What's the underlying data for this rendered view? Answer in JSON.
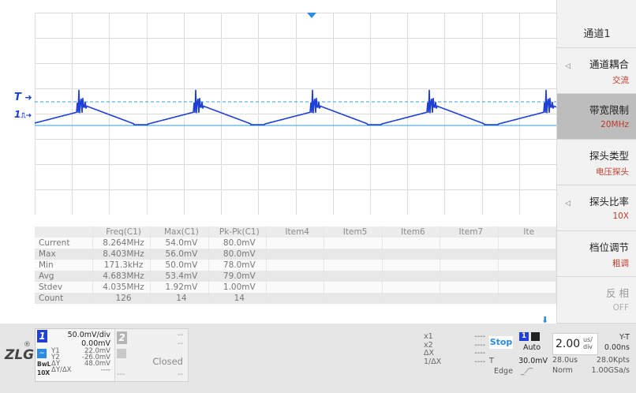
{
  "markers": {
    "trigger": "T",
    "channel": "1"
  },
  "measure": {
    "headers": [
      "",
      "Freq(C1)",
      "Max(C1)",
      "Pk-Pk(C1)",
      "Item4",
      "Item5",
      "Item6",
      "Item7",
      "Ite"
    ],
    "rows": [
      {
        "label": "Current",
        "values": [
          "8.264MHz",
          "54.0mV",
          "80.0mV",
          "",
          "",
          "",
          "",
          ""
        ]
      },
      {
        "label": "Max",
        "values": [
          "8.403MHz",
          "56.0mV",
          "80.0mV",
          "",
          "",
          "",
          "",
          ""
        ]
      },
      {
        "label": "Min",
        "values": [
          "171.3kHz",
          "50.0mV",
          "78.0mV",
          "",
          "",
          "",
          "",
          ""
        ]
      },
      {
        "label": "Avg",
        "values": [
          "4.683MHz",
          "53.4mV",
          "79.0mV",
          "",
          "",
          "",
          "",
          ""
        ]
      },
      {
        "label": "Stdev",
        "values": [
          "4.035MHz",
          "1.92mV",
          "1.00mV",
          "",
          "",
          "",
          "",
          ""
        ]
      },
      {
        "label": "Count",
        "values": [
          "126",
          "14",
          "14",
          "",
          "",
          "",
          "",
          ""
        ]
      }
    ]
  },
  "menu": {
    "title": "通道1",
    "items": [
      {
        "label": "通道耦合",
        "value": "交流"
      },
      {
        "label": "带宽限制",
        "value": "20MHz"
      },
      {
        "label": "探头类型",
        "value": "电压探头"
      },
      {
        "label": "探头比率",
        "value": "10X"
      },
      {
        "label": "档位调节",
        "value": "粗调"
      },
      {
        "label": "反 相",
        "value": "OFF"
      }
    ]
  },
  "bottom": {
    "logo": "ZLG",
    "reg": "®",
    "ch1": {
      "num": "1",
      "scale": "50.0mV/div",
      "offset": "0.00mV",
      "y1_label": "Y1",
      "y1": "22.0mV",
      "y2_label": "Y2",
      "y2": "-26.0mV",
      "dy_label": "ΔY",
      "dy": "48.0mV",
      "dydx_label": "ΔY/ΔX",
      "dydx": "----",
      "mode1": "BwL",
      "mode2": "10X"
    },
    "ch2": {
      "num": "2",
      "dash1": "--",
      "dash2": "--",
      "status": "Closed",
      "dash3": "---",
      "dash4": "--"
    },
    "cursors": {
      "x1": "x1",
      "x1v": "----",
      "x2": "x2",
      "x2v": "----",
      "dx": "ΔX",
      "dxv": "----",
      "inv": "1/ΔX",
      "invv": "----"
    },
    "trigger": {
      "state": "Stop",
      "chan": "1",
      "mode": "Auto",
      "t_label": "T",
      "level": "30.0mV",
      "type": "Edge"
    },
    "timebase": {
      "scale": "2.00",
      "unit_top": "us/",
      "unit_bottom": "div",
      "mode": "Y-T",
      "pos": "0.00ns",
      "len": "28.0us",
      "pts": "28.0Kpts",
      "acq": "Norm",
      "rate": "1.00GSa/s"
    }
  },
  "colors": {
    "trace": "#1f3fd6",
    "ref_line": "#2f9fe0",
    "menu_value": "#c0392b",
    "stop": "#2a8be0"
  }
}
